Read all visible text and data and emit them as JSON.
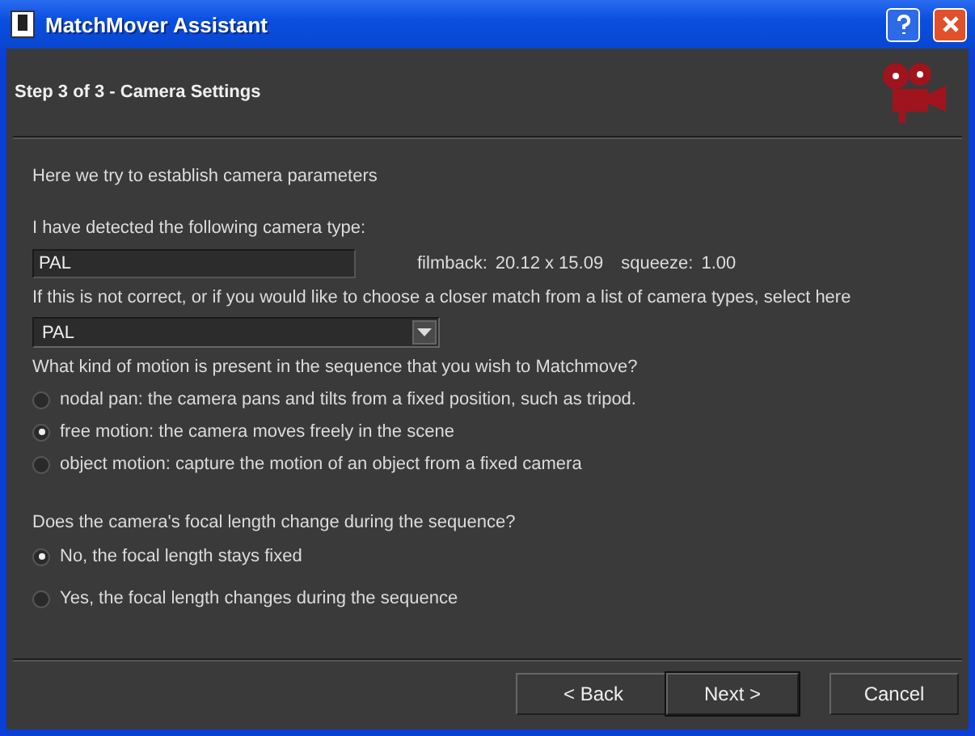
{
  "window": {
    "title": "MatchMover Assistant"
  },
  "header": {
    "title": "Step 3 of 3 - Camera Settings"
  },
  "intro": "Here we try to establish camera parameters",
  "detected": {
    "label": "I have detected the following camera type:",
    "value": "PAL",
    "filmback_label": "filmback:",
    "filmback": "20.12 x 15.09",
    "squeeze_label": "squeeze:",
    "squeeze": "1.00"
  },
  "camera_select": {
    "label": "If this is not correct, or if you would like to choose a closer match from a list of camera types, select here",
    "value": "PAL"
  },
  "motion": {
    "question": "What kind of motion is present in the sequence that you wish to Matchmove?",
    "options": [
      {
        "label": "nodal pan: the camera pans and tilts from a fixed position, such as tripod.",
        "selected": false
      },
      {
        "label": "free motion: the camera moves freely in the scene",
        "selected": true
      },
      {
        "label": "object motion: capture the motion of an object from a fixed camera",
        "selected": false
      }
    ]
  },
  "focal": {
    "question": "Does the camera's focal length change during the sequence?",
    "options": [
      {
        "label": "No, the focal length stays fixed",
        "selected": true
      },
      {
        "label": "Yes, the focal length changes during the sequence",
        "selected": false
      }
    ]
  },
  "buttons": [
    {
      "label": "< Back",
      "default": false
    },
    {
      "label": "Next >",
      "default": true
    },
    {
      "label": "Cancel",
      "default": false
    }
  ]
}
